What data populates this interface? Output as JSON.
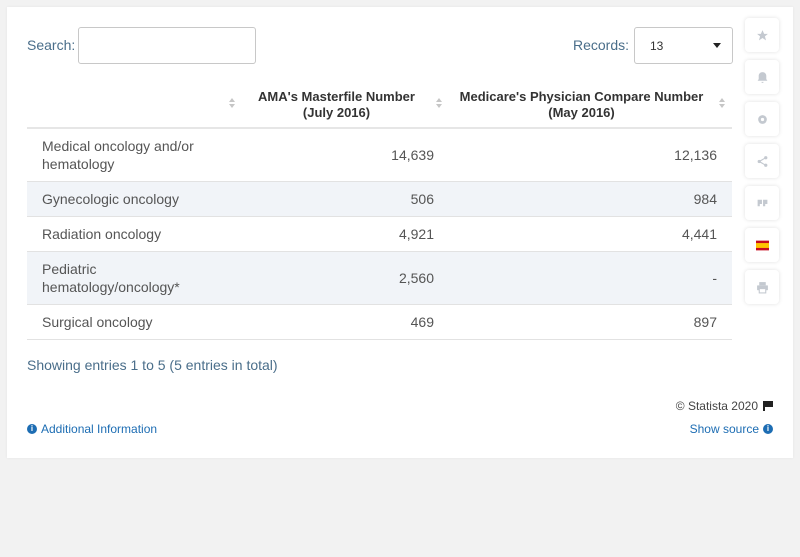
{
  "search": {
    "label": "Search:",
    "value": ""
  },
  "records": {
    "label": "Records:",
    "value": "13"
  },
  "table": {
    "headers": [
      "",
      "AMA's Masterfile Number (July 2016)",
      "Medicare's Physician Compare Number (May 2016)"
    ],
    "rows": [
      [
        "Medical oncology and/or hematology",
        "14,639",
        "12,136"
      ],
      [
        "Gynecologic oncology",
        "506",
        "984"
      ],
      [
        "Radiation oncology",
        "4,921",
        "4,441"
      ],
      [
        "Pediatric hematology/oncology*",
        "2,560",
        "-"
      ],
      [
        "Surgical oncology",
        "469",
        "897"
      ]
    ]
  },
  "footer": {
    "showing": "Showing entries 1 to 5 (5 entries in total)",
    "copyright": "© Statista 2020",
    "additional_info": "Additional Information",
    "show_source": "Show source"
  },
  "sidebar_icons": [
    "star-icon",
    "bell-icon",
    "gear-icon",
    "share-icon",
    "quote-icon",
    "spain-flag-icon",
    "print-icon"
  ],
  "chart_data": {
    "type": "table",
    "columns": [
      "",
      "AMA's Masterfile Number (July 2016)",
      "Medicare's Physician Compare Number (May 2016)"
    ],
    "categories": [
      "Medical oncology and/or hematology",
      "Gynecologic oncology",
      "Radiation oncology",
      "Pediatric hematology/oncology*",
      "Surgical oncology"
    ],
    "series": [
      {
        "name": "AMA's Masterfile Number (July 2016)",
        "values": [
          14639,
          506,
          4921,
          2560,
          469
        ]
      },
      {
        "name": "Medicare's Physician Compare Number (May 2016)",
        "values": [
          12136,
          984,
          4441,
          null,
          897
        ]
      }
    ]
  }
}
